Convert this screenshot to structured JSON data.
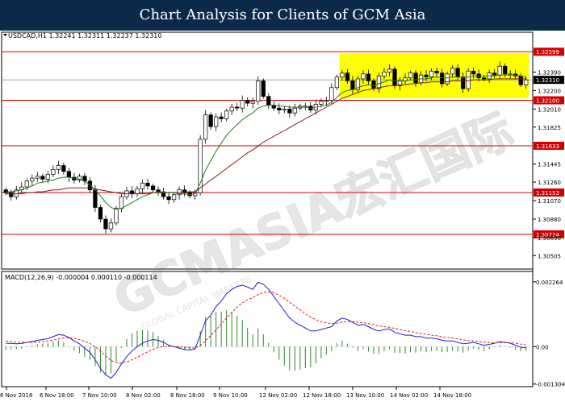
{
  "banner": {
    "title": "Chart Analysis for Clients of GCM Asia"
  },
  "watermark": {
    "text": "GCMASIA宏汇国际",
    "subtext": "GLOBAL CAPITAL MARKETS"
  },
  "colors": {
    "bull_candle": "#000000",
    "bear_candle": "#000000",
    "ma_fast": "#1a7f1a",
    "ma_slow": "#8b1a1a",
    "level_line": "#d40000",
    "level_label_bg": "#d40000",
    "highlight_box": "#ffff00",
    "current_price_bg": "#000000",
    "macd_line": "#1f1fd6",
    "macd_signal": "#e01f1f",
    "macd_hist": "#2e8b2e"
  },
  "chart_data": [
    {
      "type": "candlestick",
      "symbol_header": "USDCAD,H1  1.32241 1.32311 1.32237 1.32310",
      "ylim": [
        1.304,
        1.327
      ],
      "y_ticks": [
        1.3239,
        1.322,
        1.3201,
        1.31825,
        1.31445,
        1.3126,
        1.3107,
        1.3088,
        1.3069,
        1.30505
      ],
      "x_tick_labels": [
        "6 Nov 2018",
        "6 Nov 18:00",
        "7 Nov 10:00",
        "8 Nov 02:00",
        "8 Nov 18:00",
        "9 Nov 10:00",
        "12 Nov 02:00",
        "12 Nov 18:00",
        "13 Nov 10:00",
        "14 Nov 02:00",
        "14 Nov 18:00"
      ],
      "horizontal_levels": [
        1.32599,
        1.321,
        1.31633,
        1.31153,
        1.30724
      ],
      "level_labels": [
        "1.32599",
        "1.32100",
        "1.31633",
        "1.31153",
        "1.30724"
      ],
      "current_price": 1.3231,
      "current_price_label": "1.32310",
      "highlight_range": {
        "start_index": 64,
        "end_index": 99,
        "top": 1.3258,
        "bottom": 1.3212
      },
      "close": [
        1.3115,
        1.3111,
        1.3118,
        1.3121,
        1.3127,
        1.313,
        1.3132,
        1.3129,
        1.3134,
        1.3139,
        1.3143,
        1.3137,
        1.3131,
        1.3128,
        1.3132,
        1.3127,
        1.3118,
        1.31,
        1.3088,
        1.3078,
        1.3084,
        1.3099,
        1.3111,
        1.3117,
        1.3114,
        1.3119,
        1.3125,
        1.3122,
        1.3118,
        1.3116,
        1.3111,
        1.3108,
        1.3113,
        1.3118,
        1.3115,
        1.3112,
        1.3115,
        1.317,
        1.3195,
        1.3183,
        1.3193,
        1.3191,
        1.3199,
        1.3203,
        1.3202,
        1.321,
        1.3207,
        1.3209,
        1.323,
        1.3214,
        1.3205,
        1.3202,
        1.32,
        1.3201,
        1.3197,
        1.3202,
        1.3204,
        1.3204,
        1.32,
        1.3206,
        1.3209,
        1.321,
        1.3223,
        1.3234,
        1.3238,
        1.323,
        1.3221,
        1.3232,
        1.3237,
        1.323,
        1.3222,
        1.3235,
        1.3239,
        1.3242,
        1.3225,
        1.323,
        1.3233,
        1.3238,
        1.3228,
        1.3236,
        1.3234,
        1.324,
        1.3238,
        1.3227,
        1.3237,
        1.3243,
        1.3234,
        1.3222,
        1.324,
        1.3237,
        1.3233,
        1.3232,
        1.3238,
        1.3236,
        1.3245,
        1.3237,
        1.3237,
        1.3235,
        1.3226,
        1.3231
      ],
      "ma_fast": [
        1.3116,
        1.3116,
        1.3117,
        1.3118,
        1.312,
        1.3122,
        1.3125,
        1.3126,
        1.3127,
        1.3128,
        1.313,
        1.3131,
        1.3131,
        1.313,
        1.3129,
        1.3127,
        1.3123,
        1.3118,
        1.3112,
        1.3105,
        1.31,
        1.3098,
        1.3099,
        1.3102,
        1.3105,
        1.3108,
        1.3111,
        1.3113,
        1.3115,
        1.3116,
        1.3116,
        1.3115,
        1.3115,
        1.3114,
        1.3114,
        1.3113,
        1.3114,
        1.3125,
        1.3138,
        1.3148,
        1.3158,
        1.3166,
        1.3174,
        1.318,
        1.3185,
        1.319,
        1.3194,
        1.3197,
        1.3202,
        1.3204,
        1.3205,
        1.3205,
        1.3204,
        1.3204,
        1.3203,
        1.3203,
        1.3203,
        1.3203,
        1.3202,
        1.3203,
        1.3204,
        1.3205,
        1.3208,
        1.3213,
        1.3218,
        1.322,
        1.3221,
        1.3223,
        1.3225,
        1.3226,
        1.3225,
        1.3227,
        1.3229,
        1.3231,
        1.323,
        1.323,
        1.323,
        1.3231,
        1.3231,
        1.3232,
        1.3232,
        1.3233,
        1.3234,
        1.3233,
        1.3233,
        1.3234,
        1.3234,
        1.3233,
        1.3234,
        1.3235,
        1.3235,
        1.3235,
        1.3235,
        1.3235,
        1.3236,
        1.3236,
        1.3236,
        1.3236,
        1.3235,
        1.3234
      ],
      "ma_slow": [
        1.3114,
        1.3114,
        1.3114,
        1.3114,
        1.3115,
        1.3115,
        1.3116,
        1.3116,
        1.3117,
        1.3118,
        1.3118,
        1.3119,
        1.312,
        1.312,
        1.312,
        1.312,
        1.312,
        1.3119,
        1.3118,
        1.3117,
        1.3116,
        1.3115,
        1.3114,
        1.3114,
        1.3114,
        1.3114,
        1.3114,
        1.3114,
        1.3115,
        1.3115,
        1.3115,
        1.3115,
        1.3115,
        1.3115,
        1.3116,
        1.3116,
        1.3116,
        1.312,
        1.3124,
        1.3128,
        1.3132,
        1.3136,
        1.314,
        1.3144,
        1.3148,
        1.3152,
        1.3156,
        1.3159,
        1.3163,
        1.3167,
        1.317,
        1.3173,
        1.3176,
        1.3179,
        1.3182,
        1.3185,
        1.3188,
        1.3191,
        1.3194,
        1.3197,
        1.32,
        1.3203,
        1.3206,
        1.3209,
        1.3212,
        1.3214,
        1.3216,
        1.3218,
        1.322,
        1.3221,
        1.3222,
        1.3223,
        1.3224,
        1.3225,
        1.3225,
        1.3226,
        1.3226,
        1.3227,
        1.3227,
        1.3228,
        1.3228,
        1.3229,
        1.3229,
        1.3229,
        1.3229,
        1.323,
        1.323,
        1.323,
        1.323,
        1.3231,
        1.3231,
        1.3231,
        1.3231,
        1.3232,
        1.3232,
        1.3232,
        1.3232,
        1.3232,
        1.3232,
        1.3232
      ]
    },
    {
      "type": "macd",
      "header": "MACD(12,26,9) -0.000004 0.000110 -0.000114",
      "ylim": [
        -0.00134,
        0.00226
      ],
      "y_tick_labels": [
        "0.002264",
        "0.00",
        "-0.001304"
      ],
      "y_ticks": [
        0.002264,
        0.0,
        -0.001304
      ],
      "x_tick_labels": [
        "6 Nov 2018",
        "6 Nov 18:00",
        "7 Nov 10:00",
        "8 Nov 02:00",
        "8 Nov 18:00",
        "9 Nov 10:00",
        "12 Nov 02:00",
        "12 Nov 18:00",
        "13 Nov 10:00",
        "14 Nov 02:00",
        "14 Nov 18:00"
      ],
      "macd": [
        0.00012,
        0.00011,
        0.0001,
        0.00011,
        0.00015,
        0.00018,
        0.00022,
        0.00025,
        0.00028,
        0.00035,
        0.00042,
        0.0004,
        0.00032,
        0.0002,
        0.0001,
        -5e-05,
        -0.0002,
        -0.00045,
        -0.00075,
        -0.00098,
        -0.0011,
        -0.0009,
        -0.0006,
        -0.00035,
        -0.00015,
        0.0,
        0.00012,
        0.0002,
        0.00025,
        0.00022,
        0.00015,
        5e-05,
        0.0,
        -5e-05,
        -0.0001,
        -0.00012,
        -8e-05,
        0.0004,
        0.0009,
        0.0011,
        0.0014,
        0.0016,
        0.00185,
        0.002,
        0.0021,
        0.00215,
        0.00208,
        0.002,
        0.00225,
        0.00218,
        0.002,
        0.00175,
        0.0015,
        0.00125,
        0.001,
        0.00085,
        0.00075,
        0.00065,
        0.00055,
        0.00055,
        0.0006,
        0.00065,
        0.0007,
        0.0009,
        0.001,
        0.00095,
        0.00085,
        0.00075,
        0.00078,
        0.0007,
        0.0006,
        0.00055,
        0.0006,
        0.00062,
        0.0005,
        0.00045,
        0.0004,
        0.0004,
        0.00035,
        0.00035,
        0.0003,
        0.0003,
        0.00028,
        0.00022,
        0.0002,
        0.0002,
        0.00015,
        0.0001,
        0.00012,
        0.00015,
        0.0001,
        5e-05,
        8e-05,
        0.00012,
        0.00018,
        0.00015,
        0.00012,
        5e-05,
        -2e-05,
        -4e-05
      ],
      "signal": [
        0.0002,
        0.00018,
        0.00016,
        0.00015,
        0.00015,
        0.00015,
        0.00016,
        0.00018,
        0.0002,
        0.00023,
        0.00027,
        0.0003,
        0.00031,
        0.00029,
        0.00025,
        0.00019,
        0.00011,
        0.0,
        -0.00015,
        -0.00032,
        -0.00048,
        -0.00056,
        -0.00057,
        -0.00053,
        -0.00046,
        -0.00037,
        -0.00027,
        -0.00018,
        -9e-05,
        -3e-05,
        0.0,
        1e-05,
        1e-05,
        0.0,
        -2e-05,
        -4e-05,
        -5e-05,
        4e-05,
        0.00021,
        0.00039,
        0.00059,
        0.00079,
        0.001,
        0.0012,
        0.00138,
        0.00153,
        0.00164,
        0.00171,
        0.00182,
        0.00189,
        0.00191,
        0.00188,
        0.0018,
        0.00169,
        0.00155,
        0.00141,
        0.00128,
        0.00115,
        0.00103,
        0.00094,
        0.00087,
        0.00083,
        0.0008,
        0.00082,
        0.00086,
        0.00088,
        0.00087,
        0.00085,
        0.00084,
        0.00081,
        0.00077,
        0.00072,
        0.0007,
        0.00068,
        0.00064,
        0.0006,
        0.00056,
        0.00053,
        0.00049,
        0.00046,
        0.00043,
        0.0004,
        0.00038,
        0.00035,
        0.00032,
        0.0003,
        0.00027,
        0.00024,
        0.00021,
        0.0002,
        0.00018,
        0.00015,
        0.00014,
        0.00013,
        0.00014,
        0.00014,
        0.00014,
        0.00012,
        9e-05,
        6e-05
      ]
    }
  ]
}
